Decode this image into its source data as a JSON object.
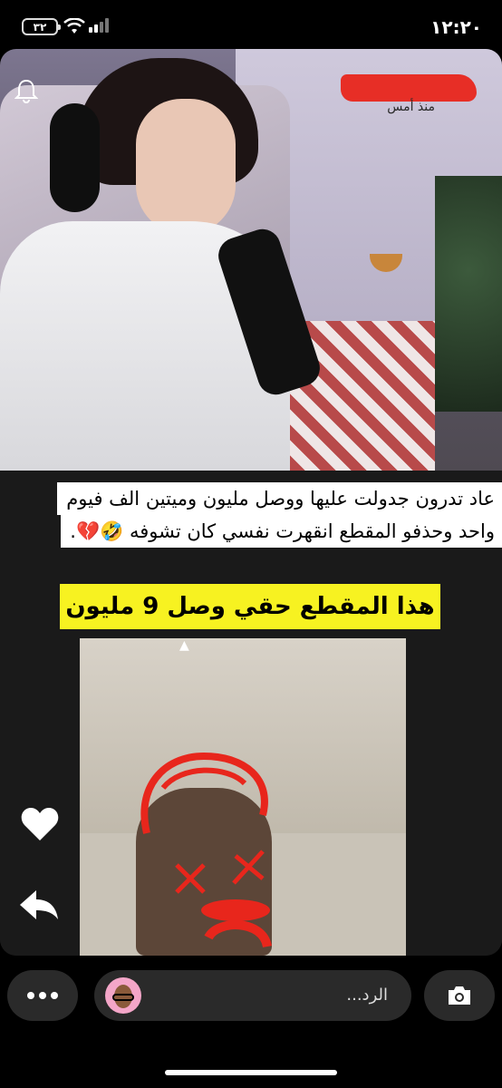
{
  "status_bar": {
    "time": "١٢:٢٠",
    "battery": "٣٢"
  },
  "story": {
    "sender_time": "منذ أمس",
    "caption_line1": "عاد تدرون جدولت عليها ووصل مليون وميتين الف فيوم",
    "caption_line2": "واحد وحذفو المقطع انقهرت نفسي كان تشوفه 🤣💔.",
    "highlight": "هذا المقطع حقي وصل 9 مليون"
  },
  "bottom_bar": {
    "reply_placeholder": "الرد..."
  },
  "colors": {
    "highlight": "#f7f221",
    "scribble": "#e8261c"
  }
}
